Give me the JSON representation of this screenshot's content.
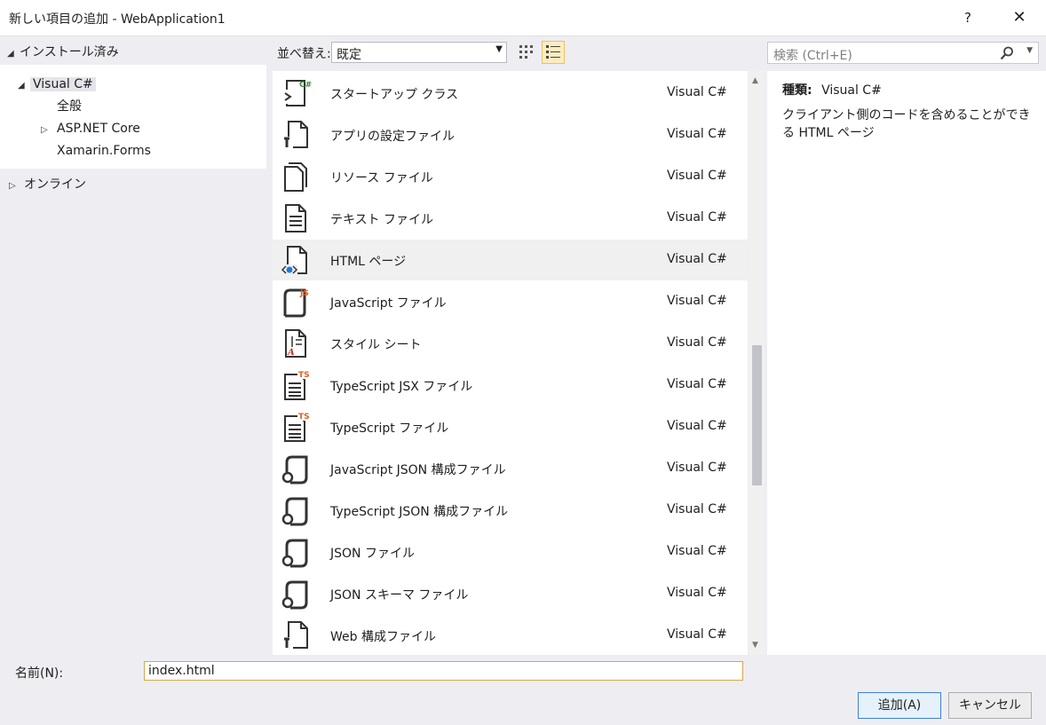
{
  "window": {
    "title": "新しい項目の追加 - WebApplication1",
    "help": "?",
    "close": "✕"
  },
  "tree": {
    "installed": "インストール済み",
    "visual_csharp": "Visual C#",
    "general": "全般",
    "aspnet_core": "ASP.NET Core",
    "xamarin_forms": "Xamarin.Forms",
    "online": "オンライン"
  },
  "toolbar": {
    "sort_label": "並べ替え:",
    "sort_value": "既定",
    "search_placeholder": "検索 (Ctrl+E)"
  },
  "templates": [
    {
      "name": "スタートアップ クラス",
      "lang": "Visual C#",
      "icon": "startup-class-icon"
    },
    {
      "name": "アプリの設定ファイル",
      "lang": "Visual C#",
      "icon": "app-settings-icon"
    },
    {
      "name": "リソース ファイル",
      "lang": "Visual C#",
      "icon": "resource-file-icon"
    },
    {
      "name": "テキスト ファイル",
      "lang": "Visual C#",
      "icon": "text-file-icon"
    },
    {
      "name": "HTML ページ",
      "lang": "Visual C#",
      "icon": "html-page-icon",
      "selected": true
    },
    {
      "name": "JavaScript ファイル",
      "lang": "Visual C#",
      "icon": "javascript-file-icon"
    },
    {
      "name": "スタイル シート",
      "lang": "Visual C#",
      "icon": "stylesheet-icon"
    },
    {
      "name": "TypeScript JSX ファイル",
      "lang": "Visual C#",
      "icon": "typescript-jsx-icon"
    },
    {
      "name": "TypeScript ファイル",
      "lang": "Visual C#",
      "icon": "typescript-file-icon"
    },
    {
      "name": "JavaScript JSON 構成ファイル",
      "lang": "Visual C#",
      "icon": "js-json-config-icon"
    },
    {
      "name": "TypeScript JSON 構成ファイル",
      "lang": "Visual C#",
      "icon": "ts-json-config-icon"
    },
    {
      "name": "JSON ファイル",
      "lang": "Visual C#",
      "icon": "json-file-icon"
    },
    {
      "name": "JSON スキーマ ファイル",
      "lang": "Visual C#",
      "icon": "json-schema-icon"
    },
    {
      "name": "Web 構成ファイル",
      "lang": "Visual C#",
      "icon": "web-config-icon"
    }
  ],
  "details": {
    "type_label": "種類:",
    "type_value": "Visual C#",
    "description": "クライアント側のコードを含めることができる HTML ページ"
  },
  "footer": {
    "name_label": "名前(N):",
    "name_value": "index.html",
    "add_button": "追加(A)",
    "cancel_button": "キャンセル"
  }
}
